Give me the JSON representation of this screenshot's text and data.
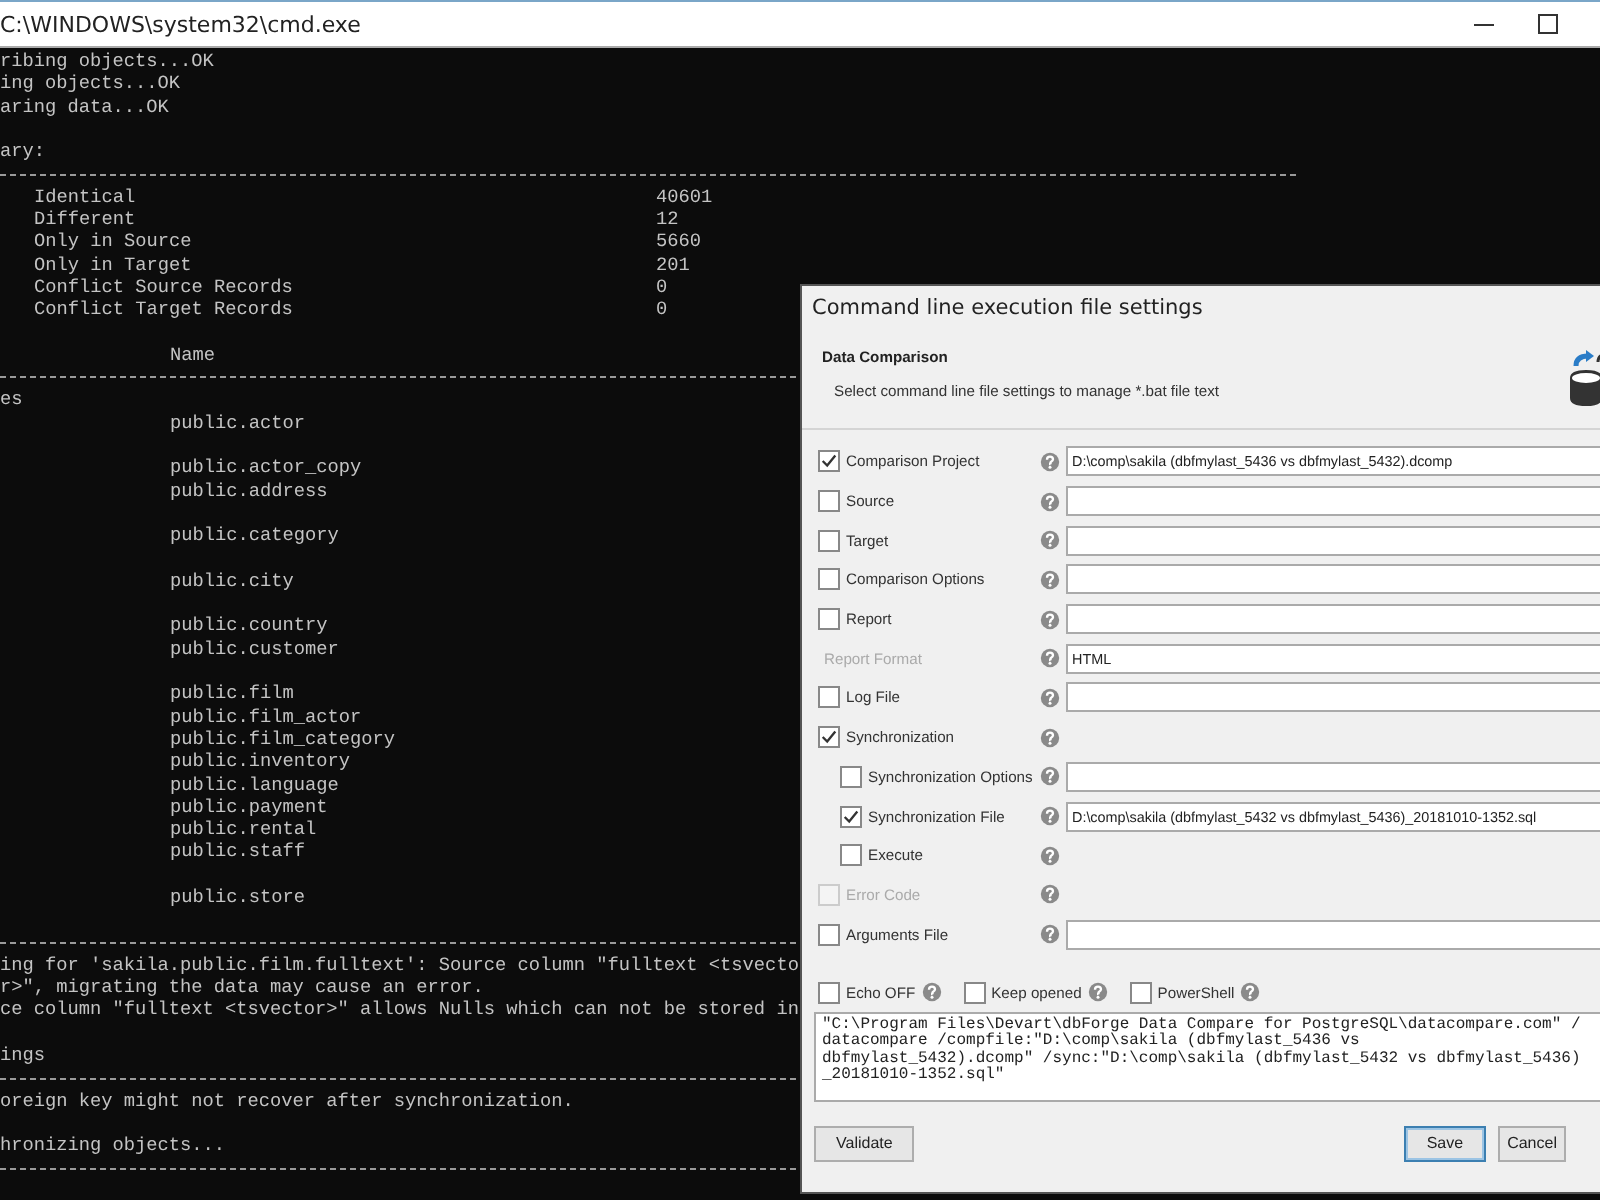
{
  "console": {
    "title": "C:\\WINDOWS\\system32\\cmd.exe",
    "lines": [
      {
        "kind": "text",
        "text": "ribing objects...OK"
      },
      {
        "kind": "text",
        "text": "ing objects...OK"
      },
      {
        "kind": "text",
        "text": "aring data...OK"
      },
      {
        "kind": "blank"
      },
      {
        "kind": "text",
        "text": "ary:"
      },
      {
        "kind": "rule"
      },
      {
        "kind": "summary",
        "label": "Identical",
        "value": "40601"
      },
      {
        "kind": "summary",
        "label": "Different",
        "value": "12"
      },
      {
        "kind": "summary",
        "label": "Only in Source",
        "value": "5660"
      },
      {
        "kind": "summary",
        "label": "Only in Target",
        "value": "201"
      },
      {
        "kind": "summary",
        "label": "Conflict Source Records",
        "value": "0"
      },
      {
        "kind": "summary",
        "label": "Conflict Target Records",
        "value": "0"
      },
      {
        "kind": "blank"
      },
      {
        "kind": "item",
        "text": "Name"
      },
      {
        "kind": "rule"
      },
      {
        "kind": "text",
        "text": "es"
      },
      {
        "kind": "item",
        "text": "public.actor"
      },
      {
        "kind": "blank"
      },
      {
        "kind": "item",
        "text": "public.actor_copy"
      },
      {
        "kind": "item",
        "text": "public.address"
      },
      {
        "kind": "blank"
      },
      {
        "kind": "item",
        "text": "public.category"
      },
      {
        "kind": "blank"
      },
      {
        "kind": "item",
        "text": "public.city"
      },
      {
        "kind": "blank"
      },
      {
        "kind": "item",
        "text": "public.country"
      },
      {
        "kind": "item",
        "text": "public.customer"
      },
      {
        "kind": "blank"
      },
      {
        "kind": "item",
        "text": "public.film"
      },
      {
        "kind": "item",
        "text": "public.film_actor"
      },
      {
        "kind": "item",
        "text": "public.film_category"
      },
      {
        "kind": "item",
        "text": "public.inventory"
      },
      {
        "kind": "item",
        "text": "public.language"
      },
      {
        "kind": "item",
        "text": "public.payment"
      },
      {
        "kind": "item",
        "text": "public.rental"
      },
      {
        "kind": "item",
        "text": "public.staff"
      },
      {
        "kind": "blank"
      },
      {
        "kind": "item",
        "text": "public.store"
      },
      {
        "kind": "blank"
      },
      {
        "kind": "rule"
      },
      {
        "kind": "text",
        "text": "ing for 'sakila.public.film.fulltext': Source column \"fulltext <tsvecto"
      },
      {
        "kind": "text",
        "text": "r>\", migrating the data may cause an error."
      },
      {
        "kind": "text",
        "text": "ce column \"fulltext <tsvector>\" allows Nulls which can not be stored in"
      },
      {
        "kind": "blank"
      },
      {
        "kind": "text",
        "text": "ings"
      },
      {
        "kind": "rule"
      },
      {
        "kind": "text",
        "text": "oreign key might not recover after synchronization."
      },
      {
        "kind": "blank"
      },
      {
        "kind": "text",
        "text": "hronizing objects..."
      },
      {
        "kind": "rule"
      }
    ]
  },
  "dialog": {
    "title": "Command line execution file settings",
    "heading": "Data Comparison",
    "subtitle": "Select command line file settings to manage *.bat file text",
    "rows": [
      {
        "kind": "check_field",
        "label": "Comparison Project",
        "checked": true,
        "disabled": false,
        "value": "D:\\comp\\sakila (dbfmylast_5436 vs dbfmylast_5432).dcomp"
      },
      {
        "kind": "check_field",
        "label": "Source",
        "checked": false,
        "disabled": false
      },
      {
        "kind": "check_field",
        "label": "Target",
        "checked": false,
        "disabled": false
      },
      {
        "kind": "check_field",
        "label": "Comparison Options",
        "checked": false,
        "disabled": false
      },
      {
        "kind": "check_field",
        "label": "Report",
        "checked": false,
        "disabled": false
      },
      {
        "kind": "label_field",
        "label": "Report Format",
        "disabled": true,
        "value": "HTML"
      },
      {
        "kind": "check_field",
        "label": "Log File",
        "checked": false,
        "disabled": false
      },
      {
        "kind": "check",
        "label": "Synchronization",
        "checked": true,
        "disabled": false,
        "children": [
          {
            "kind": "check_field",
            "label": "Synchronization Options",
            "checked": false,
            "disabled": false
          },
          {
            "kind": "check_field",
            "label": "Synchronization File",
            "checked": true,
            "disabled": false,
            "value": "D:\\comp\\sakila (dbfmylast_5432 vs dbfmylast_5436)_20181010-1352.sql"
          },
          {
            "kind": "check",
            "label": "Execute",
            "checked": false,
            "disabled": false
          }
        ]
      },
      {
        "kind": "check",
        "label": "Error Code",
        "checked": false,
        "disabled": true
      },
      {
        "kind": "check_field",
        "label": "Arguments File",
        "checked": false,
        "disabled": false
      }
    ],
    "options": [
      {
        "label": "Echo OFF",
        "checked": false
      },
      {
        "label": "Keep opened",
        "checked": false
      },
      {
        "label": "PowerShell",
        "checked": false
      }
    ],
    "command_lines": [
      "\"C:\\Program Files\\Devart\\dbForge Data Compare for PostgreSQL\\datacompare.com\" /",
      "datacompare /compfile:\"D:\\comp\\sakila (dbfmylast_5436 vs",
      "dbfmylast_5432).dcomp\" /sync:\"D:\\comp\\sakila (dbfmylast_5432 vs dbfmylast_5436)",
      "_20181010-1352.sql\""
    ],
    "buttons": [
      {
        "kind": "plain",
        "label": "Validate"
      },
      {
        "kind": "default",
        "label": "Save"
      },
      {
        "kind": "plain",
        "label": "Cancel"
      }
    ]
  }
}
